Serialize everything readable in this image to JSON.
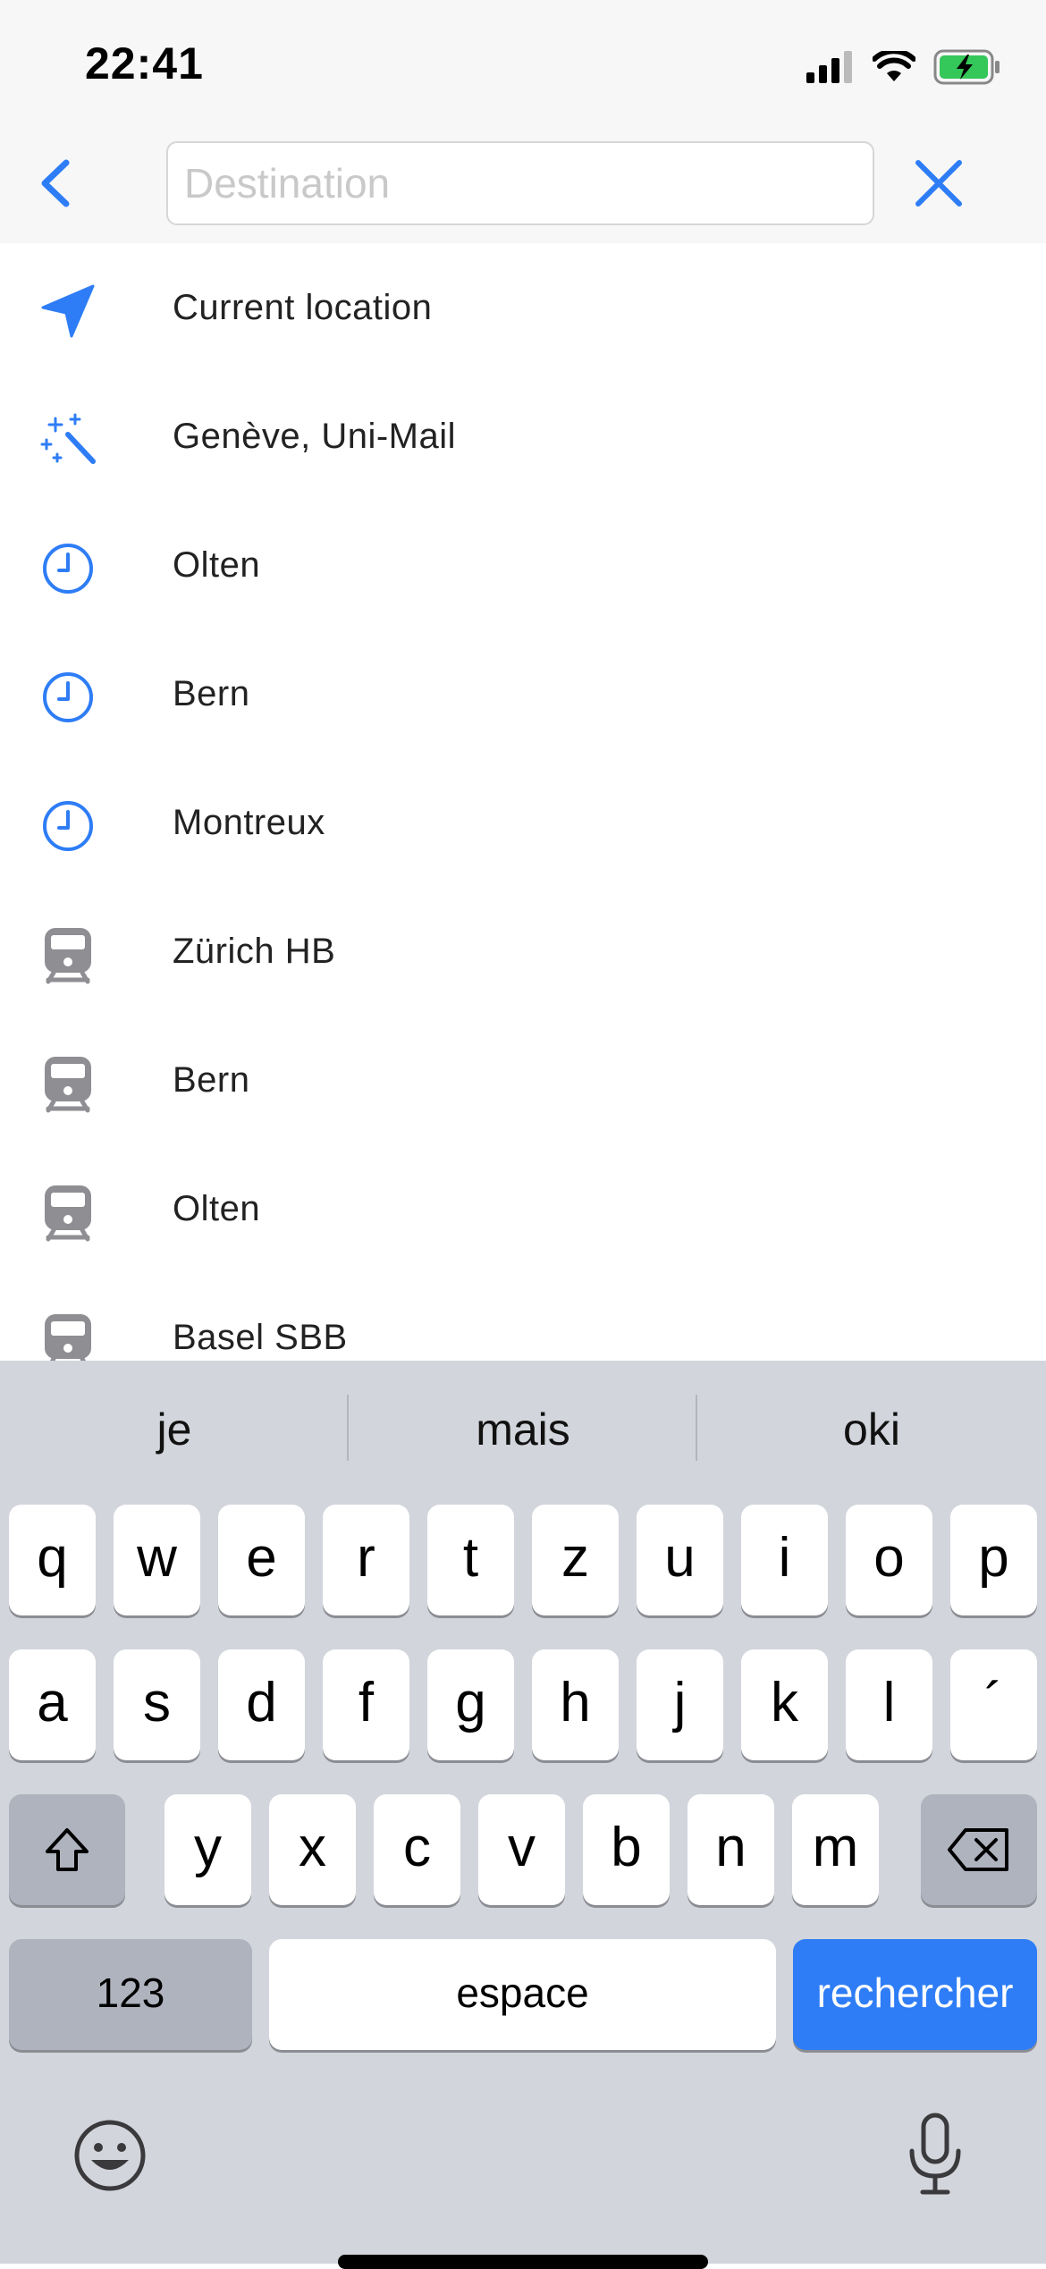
{
  "status_bar": {
    "time": "22:41"
  },
  "search": {
    "placeholder": "Destination",
    "value": ""
  },
  "list": {
    "items": [
      {
        "label": "Current location",
        "icon": "location-arrow-icon"
      },
      {
        "label": "Genève, Uni-Mail",
        "icon": "magic-wand-icon"
      },
      {
        "label": "Olten",
        "icon": "clock-icon"
      },
      {
        "label": "Bern",
        "icon": "clock-icon"
      },
      {
        "label": "Montreux",
        "icon": "clock-icon"
      },
      {
        "label": "Zürich HB",
        "icon": "train-icon"
      },
      {
        "label": "Bern",
        "icon": "train-icon"
      },
      {
        "label": "Olten",
        "icon": "train-icon"
      },
      {
        "label": "Basel SBB",
        "icon": "train-icon"
      }
    ]
  },
  "keyboard": {
    "suggestions": [
      "je",
      "mais",
      "oki"
    ],
    "row1": [
      "q",
      "w",
      "e",
      "r",
      "t",
      "z",
      "u",
      "i",
      "o",
      "p"
    ],
    "row2": [
      "a",
      "s",
      "d",
      "f",
      "g",
      "h",
      "j",
      "k",
      "l",
      "´"
    ],
    "row3": [
      "y",
      "x",
      "c",
      "v",
      "b",
      "n",
      "m"
    ],
    "numbers_label": "123",
    "space_label": "espace",
    "search_label": "rechercher"
  },
  "colors": {
    "accent": "#2e7df6",
    "train_icon": "#8e8e93",
    "keyboard_bg": "#d3d5dc",
    "battery_fill": "#34c759"
  }
}
